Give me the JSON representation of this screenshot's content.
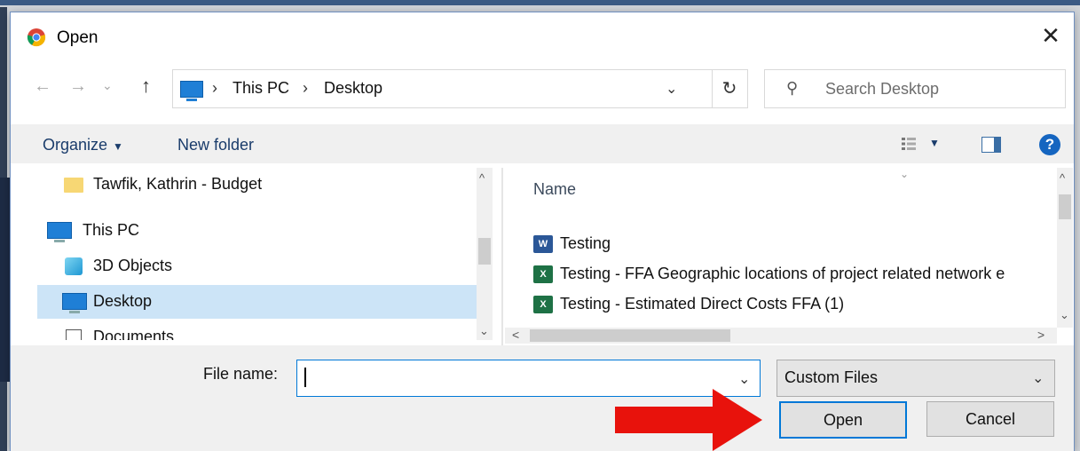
{
  "dialog": {
    "title": "Open",
    "close_glyph": "✕"
  },
  "nav": {
    "back_glyph": "←",
    "forward_glyph": "→",
    "recent_glyph": "⌄",
    "up_glyph": "↑",
    "breadcrumbs": [
      "This PC",
      "Desktop"
    ],
    "breadcrumb_sep": "›",
    "address_dropdown_glyph": "⌄",
    "refresh_glyph": "↻",
    "search_placeholder": "Search Desktop",
    "search_glyph": "⚲"
  },
  "toolbar": {
    "organize_label": "Organize",
    "organize_caret": "▼",
    "new_folder_label": "New folder",
    "view_caret": "▼",
    "help_glyph": "?"
  },
  "left_pane": {
    "items": [
      {
        "label": "Tawfik, Kathrin - Budget",
        "icon": "folder-icon"
      },
      {
        "label": "This PC",
        "icon": "computer-icon"
      },
      {
        "label": "3D Objects",
        "icon": "3d-objects-icon"
      },
      {
        "label": "Desktop",
        "icon": "desktop-icon",
        "selected": true
      },
      {
        "label": "Documents",
        "icon": "documents-icon"
      }
    ],
    "scroll_up": "^",
    "scroll_down": "⌄"
  },
  "file_list": {
    "column_sort_glyph": "⌄",
    "column_name": "Name",
    "files": [
      {
        "name": "Testing",
        "type": "word",
        "icon_text": "W"
      },
      {
        "name": "Testing - FFA Geographic locations of project related network e",
        "type": "excel",
        "icon_text": "X"
      },
      {
        "name": "Testing - Estimated Direct Costs FFA (1)",
        "type": "excel",
        "icon_text": "X"
      }
    ],
    "scroll_up": "^",
    "scroll_down": "⌄",
    "scroll_left": "<",
    "scroll_right": ">"
  },
  "footer": {
    "file_name_label": "File name:",
    "file_name_value": "",
    "file_name_dropdown_glyph": "⌄",
    "file_type_value": "Custom Files",
    "file_type_dropdown_glyph": "⌄",
    "open_label": "Open",
    "cancel_label": "Cancel"
  },
  "colors": {
    "accent": "#0078d7",
    "selection": "#cce4f7",
    "arrow": "#e8120c"
  }
}
